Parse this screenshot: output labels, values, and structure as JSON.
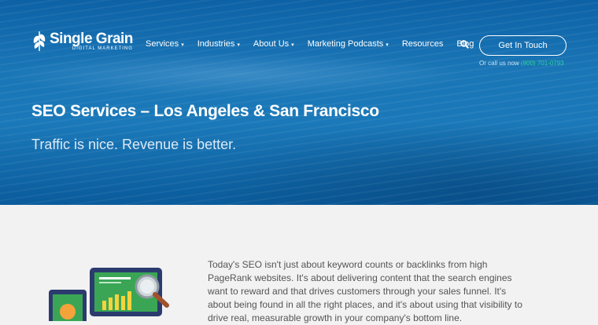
{
  "brand": {
    "name": "Single Grain",
    "tagline": "DIGITAL MARKETING"
  },
  "nav": {
    "items": [
      {
        "label": "Services",
        "caret": "▾"
      },
      {
        "label": "Industries",
        "caret": "▾"
      },
      {
        "label": "About Us",
        "caret": "▾"
      },
      {
        "label": "Marketing Podcasts",
        "caret": "▾"
      },
      {
        "label": "Resources",
        "caret": ""
      },
      {
        "label": "Blog",
        "caret": ""
      }
    ],
    "cta_label": "Get In Touch",
    "call_prefix": "Or call us now",
    "phone": "(800) 701-0793"
  },
  "hero": {
    "title": "SEO Services – Los Angeles & San Francisco",
    "subtitle": "Traffic is nice. Revenue is better."
  },
  "intro": {
    "text": "Today's SEO isn't just about keyword counts or backlinks from high PageRank websites. It's about delivering content that the search engines want to reward and that drives customers through your sales funnel. It's about being found in all the right places, and it's about using that visibility to drive real, measurable growth in your company's bottom line."
  },
  "colors": {
    "accent_green": "#2fcf9a",
    "hero_blue": "#1b79b9"
  }
}
